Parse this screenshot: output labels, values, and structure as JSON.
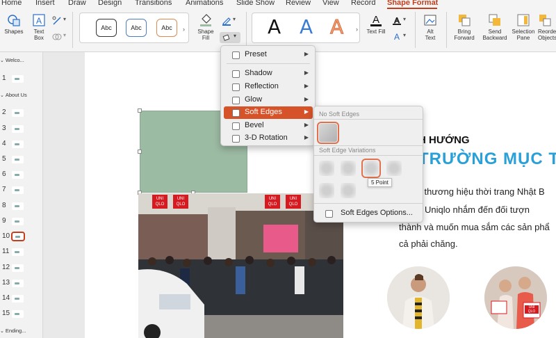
{
  "tabs": [
    "Home",
    "Insert",
    "Draw",
    "Design",
    "Transitions",
    "Animations",
    "Slide Show",
    "Review",
    "View",
    "Record",
    "Shape Format"
  ],
  "active_tab": "Shape Format",
  "ribbon": {
    "shapes": "Shapes",
    "text_box": "Text Box",
    "shape_styles": [
      "Abc",
      "Abc",
      "Abc"
    ],
    "shape_fill": "Shape Fill",
    "wordart": [
      "A",
      "A",
      "A"
    ],
    "text_fill": "Text Fill",
    "alt_text": "Alt Text",
    "bring_forward": "Bring Forward",
    "send_backward": "Send Backward",
    "selection_pane": "Selection Pane",
    "reorder_objects": "Reorder Objects"
  },
  "colors": {
    "accent": "#c43e1c",
    "highlight": "#d6532a",
    "shape_green": "#9cbba3",
    "heading_blue": "#2aa0d8"
  },
  "sections": [
    {
      "name": "Welco..."
    },
    {
      "name": "About Us"
    },
    {
      "name": "Ending..."
    }
  ],
  "slide_numbers": [
    "1",
    "2",
    "3",
    "4",
    "5",
    "6",
    "7",
    "8",
    "9",
    "10",
    "11",
    "12",
    "13",
    "14",
    "15"
  ],
  "selected_slide": "10",
  "effects_menu": {
    "items": [
      "Preset",
      "Shadow",
      "Reflection",
      "Glow",
      "Soft Edges",
      "Bevel",
      "3-D Rotation"
    ],
    "highlighted": "Soft Edges"
  },
  "soft_edges_menu": {
    "no_soft_edges": "No Soft Edges",
    "variations_header": "Soft Edge Variations",
    "tooltip": "5 Point",
    "options": "Soft Edges Options..."
  },
  "slide_content": {
    "heading": "H HƯỚNG",
    "subheading": "TRƯỜNG MỤC T",
    "body_lines": [
      "ột thương hiệu thời trang Nhật B",
      "ới Uniqlo nhắm đến đối tượn",
      "thành và muốn mua sắm các sản phẩ",
      "cả phải chăng."
    ],
    "store_signs": [
      "UNI QLO",
      "UNI QLO",
      "UNI QLO",
      "UNI QLO"
    ],
    "bag_label": "UNI QLO"
  }
}
